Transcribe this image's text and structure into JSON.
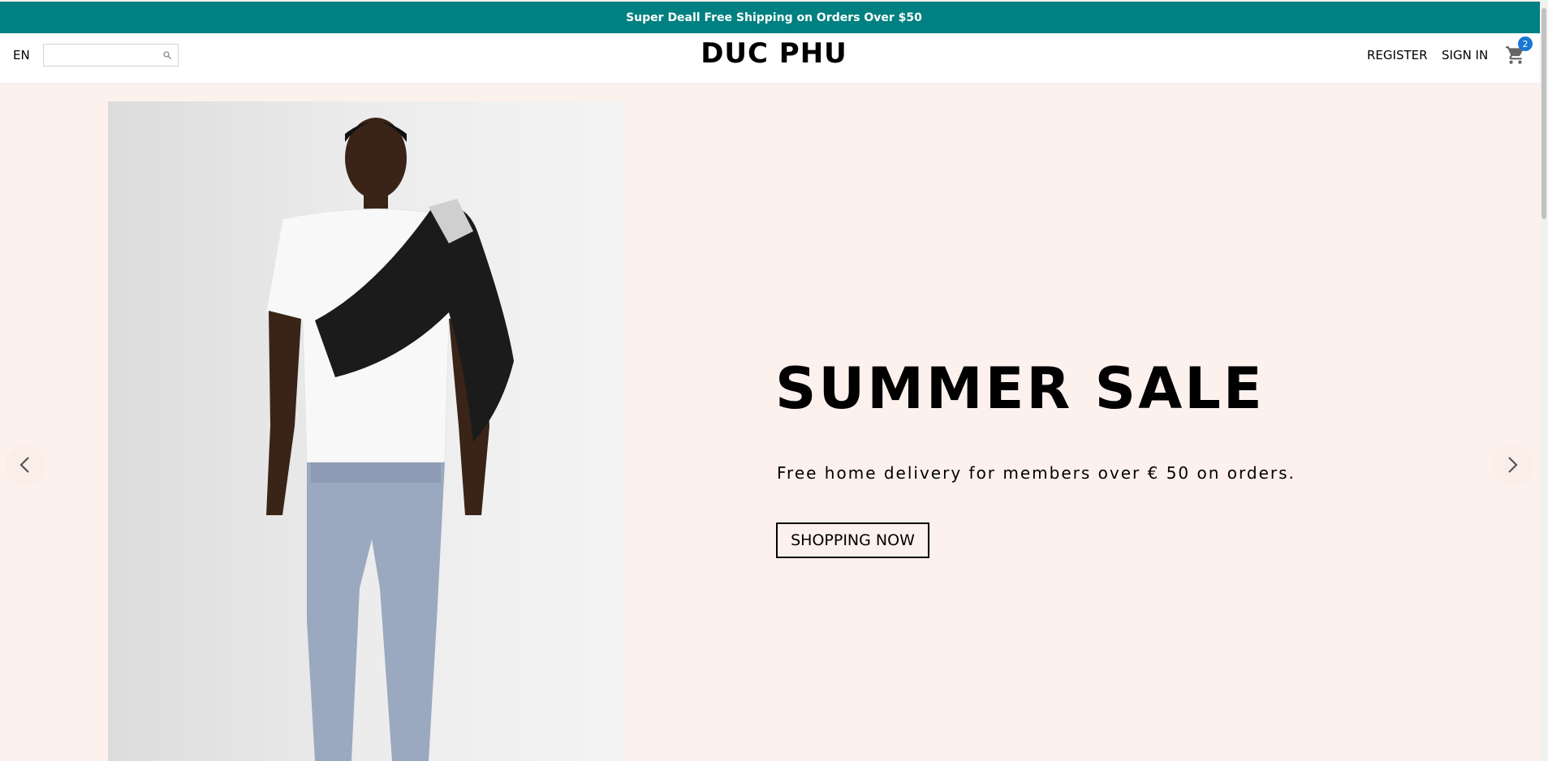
{
  "announcement": "Super Deall Free Shipping on Orders Over $50",
  "nav": {
    "language": "EN",
    "search_value": "",
    "logo": "DUC PHU",
    "register": "REGISTER",
    "sign_in": "SIGN IN",
    "cart_count": "2"
  },
  "hero": {
    "title": "SUMMER SALE",
    "description": "Free home delivery for members over € 50 on orders.",
    "button": "SHOPPING NOW"
  },
  "icons": {
    "search": "search-icon",
    "cart": "shopping-cart-icon",
    "prev": "chevron-left-icon",
    "next": "chevron-right-icon"
  },
  "colors": {
    "announcement_bg": "#008080",
    "hero_bg": "#fcf1ed",
    "badge": "#1976d2"
  }
}
